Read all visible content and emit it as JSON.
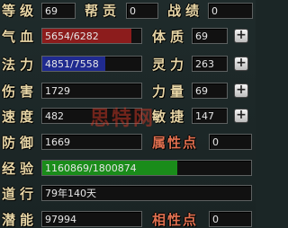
{
  "stats": {
    "level": {
      "label": "等级",
      "value": "69"
    },
    "contribution": {
      "label": "帮贡",
      "value": "0"
    },
    "battle_merit": {
      "label": "战绩",
      "value": "0"
    },
    "hp": {
      "label": "气血",
      "value": "5654/6282",
      "fraction": 0.9,
      "color": "#8c1c1c"
    },
    "constitution": {
      "label": "体质",
      "value": "69"
    },
    "mp": {
      "label": "法力",
      "value": "4851/7558",
      "fraction": 0.64,
      "color": "#1f2a8f"
    },
    "spirit": {
      "label": "灵力",
      "value": "263"
    },
    "damage": {
      "label": "伤害",
      "value": "1729"
    },
    "strength": {
      "label": "力量",
      "value": "69"
    },
    "speed": {
      "label": "速度",
      "value": "482"
    },
    "agility": {
      "label": "敏捷",
      "value": "147"
    },
    "defense": {
      "label": "防御",
      "value": "1669"
    },
    "attr_points": {
      "label": "属性点",
      "value": "0"
    },
    "exp": {
      "label": "经验",
      "value": "1160869/1800874",
      "fraction": 0.645,
      "color": "#1a8c1a"
    },
    "cultivation": {
      "label": "道行",
      "value": "79年140天"
    },
    "potential": {
      "label": "潜能",
      "value": "97994"
    },
    "affinity_points": {
      "label": "相性点",
      "value": "0"
    }
  },
  "plus_symbol": "+",
  "watermark": "思特网"
}
